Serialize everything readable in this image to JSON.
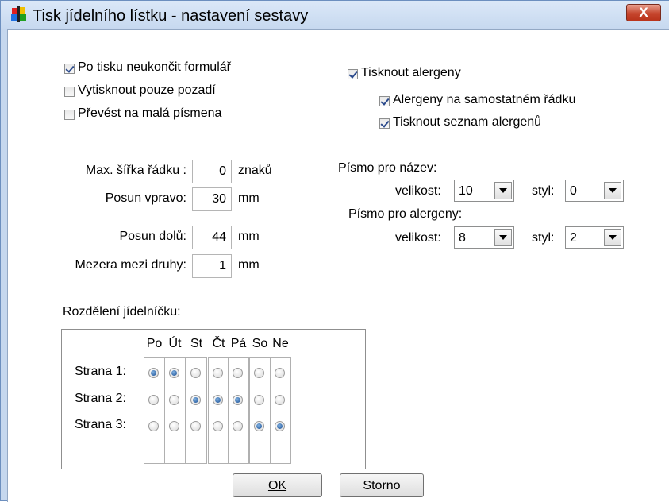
{
  "window": {
    "title": "Tisk jídelního lístku - nastavení sestavy",
    "close_label": "X"
  },
  "options": {
    "po_tisku": {
      "label": "Po tisku neukončit formulář",
      "checked": true
    },
    "pouze_pozadi": {
      "label": "Vytisknout pouze pozadí",
      "checked": false
    },
    "mala_pismena": {
      "label": "Převést na malá písmena",
      "checked": false
    },
    "tisknout_alergeny": {
      "label": "Tisknout alergeny",
      "checked": true
    },
    "alergeny_radek": {
      "label": "Alergeny na samostatném řádku",
      "checked": true
    },
    "seznam_alergenu": {
      "label": "Tisknout seznam alergenů",
      "checked": true
    }
  },
  "fields": {
    "max_sirka": {
      "label": "Max. šířka řádku :",
      "value": "0",
      "unit": "znaků"
    },
    "posun_vpravo": {
      "label": "Posun vpravo:",
      "value": "30",
      "unit": "mm"
    },
    "posun_dolu": {
      "label": "Posun dolů:",
      "value": "44",
      "unit": "mm"
    },
    "mezera": {
      "label": "Mezera mezi druhy:",
      "value": "1",
      "unit": "mm"
    }
  },
  "fonts": {
    "nazev": {
      "heading": "Písmo pro název:",
      "size_label": "velikost:",
      "size": "10",
      "style_label": "styl:",
      "style": "0"
    },
    "alergeny": {
      "heading": "Písmo pro alergeny:",
      "size_label": "velikost:",
      "size": "8",
      "style_label": "styl:",
      "style": "2"
    }
  },
  "split": {
    "heading": "Rozdělení jídelníčku:",
    "days": [
      "Po",
      "Út",
      "St",
      "Čt",
      "Pá",
      "So",
      "Ne"
    ],
    "rows": [
      {
        "label": "Strana 1:",
        "selected": [
          true,
          true,
          false,
          false,
          false,
          false,
          false
        ]
      },
      {
        "label": "Strana 2:",
        "selected": [
          false,
          false,
          true,
          true,
          true,
          false,
          false
        ]
      },
      {
        "label": "Strana 3:",
        "selected": [
          false,
          false,
          false,
          false,
          false,
          true,
          true
        ]
      }
    ]
  },
  "buttons": {
    "ok": "OK",
    "cancel": "Storno"
  },
  "colors": {
    "accent": "#1b4f94",
    "close": "#c5452d"
  }
}
